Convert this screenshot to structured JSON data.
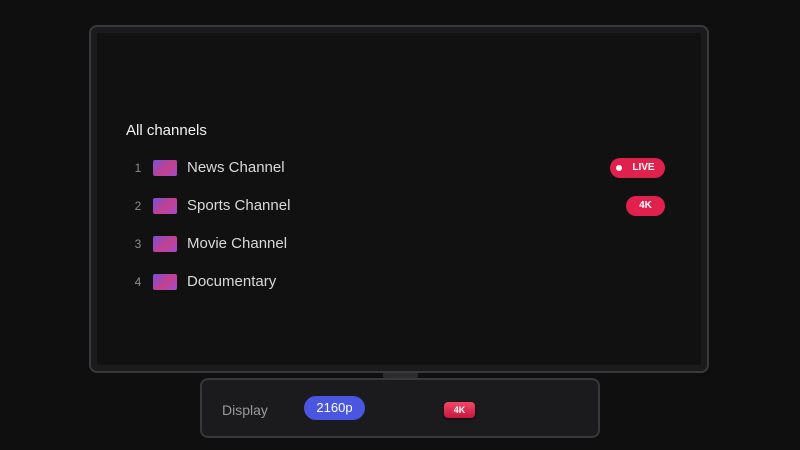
{
  "channel_list": {
    "title": "All channels",
    "channels": [
      {
        "number": "1",
        "name": "News Channel",
        "logo_icon": "channel-logo-icon",
        "badge": "LIVE"
      },
      {
        "number": "2",
        "name": "Sports Channel",
        "logo_icon": "channel-logo-icon",
        "badge": "4K"
      },
      {
        "number": "3",
        "name": "Movie Channel",
        "logo_icon": "channel-logo-icon",
        "badge": ""
      },
      {
        "number": "4",
        "name": "Documentary",
        "logo_icon": "channel-logo-icon",
        "badge": ""
      }
    ]
  },
  "display_panel": {
    "label": "Display",
    "resolution": "2160p",
    "quality_badge": "4K"
  },
  "colors": {
    "background": "#0f0f10",
    "screen": "#111112",
    "badge_red": "#e0204d",
    "resolution_blue": "#4a56e0",
    "logo_gradient_start": "#7b4fd6",
    "logo_gradient_end": "#c4408e"
  }
}
